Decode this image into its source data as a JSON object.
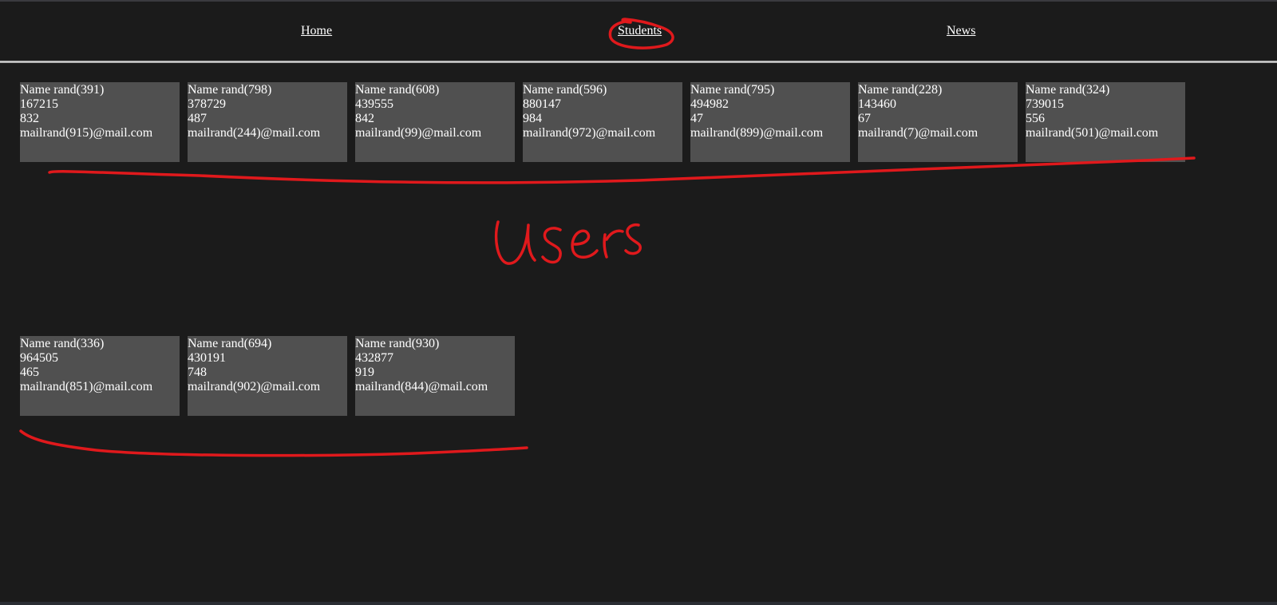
{
  "nav": {
    "items": [
      {
        "label": "Home"
      },
      {
        "label": "Students"
      },
      {
        "label": "News"
      }
    ]
  },
  "cards_row1": [
    {
      "name": "Name rand(391)",
      "id": "167215",
      "num": "832",
      "email": "mailrand(915)@mail.com"
    },
    {
      "name": "Name rand(798)",
      "id": "378729",
      "num": "487",
      "email": "mailrand(244)@mail.com"
    },
    {
      "name": "Name rand(608)",
      "id": "439555",
      "num": "842",
      "email": "mailrand(99)@mail.com"
    },
    {
      "name": "Name rand(596)",
      "id": "880147",
      "num": "984",
      "email": "mailrand(972)@mail.com"
    },
    {
      "name": "Name rand(795)",
      "id": "494982",
      "num": "47",
      "email": "mailrand(899)@mail.com"
    },
    {
      "name": "Name rand(228)",
      "id": "143460",
      "num": "67",
      "email": "mailrand(7)@mail.com"
    },
    {
      "name": "Name rand(324)",
      "id": "739015",
      "num": "556",
      "email": "mailrand(501)@mail.com"
    }
  ],
  "cards_row2": [
    {
      "name": "Name rand(336)",
      "id": "964505",
      "num": "465",
      "email": "mailrand(851)@mail.com"
    },
    {
      "name": "Name rand(694)",
      "id": "430191",
      "num": "748",
      "email": "mailrand(902)@mail.com"
    },
    {
      "name": "Name rand(930)",
      "id": "432877",
      "num": "919",
      "email": "mailrand(844)@mail.com"
    }
  ],
  "annotation": {
    "handwritten_text": "users",
    "color": "#e0191c"
  },
  "colors": {
    "background": "#1b1b1b",
    "card": "#505050",
    "text": "#ffffff"
  }
}
